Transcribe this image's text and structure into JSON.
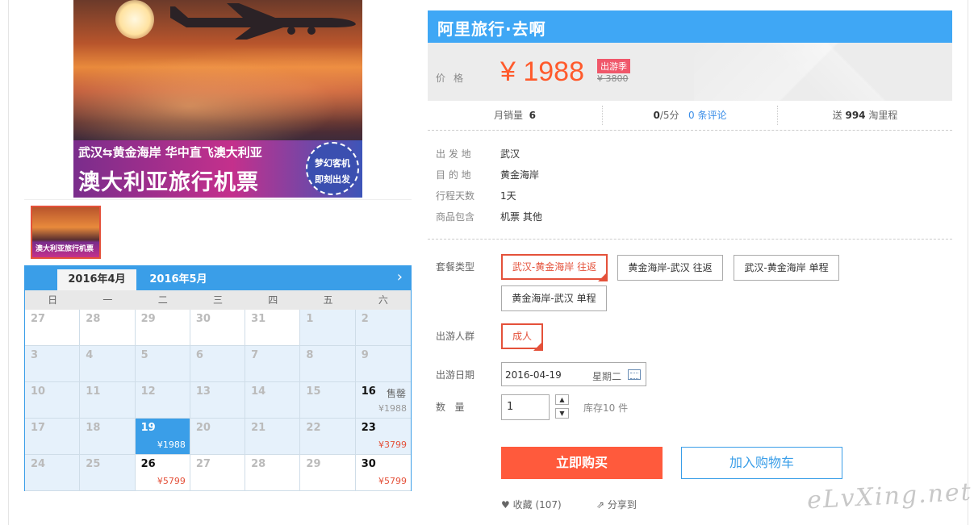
{
  "hero": {
    "line1": "武汉⇆黄金海岸 华中直飞澳大利亚",
    "line2": "澳大利亚旅行机票",
    "stamp_line1": "梦幻客机",
    "stamp_line2": "即刻出发"
  },
  "calendar": {
    "tabs": [
      "2016年4月",
      "2016年5月"
    ],
    "weekdays": [
      "日",
      "一",
      "二",
      "三",
      "四",
      "五",
      "六"
    ],
    "cells": [
      {
        "day": "27",
        "price": "",
        "status": "",
        "state": "white"
      },
      {
        "day": "28",
        "price": "",
        "status": "",
        "state": "white"
      },
      {
        "day": "29",
        "price": "",
        "status": "",
        "state": "white"
      },
      {
        "day": "30",
        "price": "",
        "status": "",
        "state": "white"
      },
      {
        "day": "31",
        "price": "",
        "status": "",
        "state": "white"
      },
      {
        "day": "1",
        "price": "",
        "status": "",
        "state": "off"
      },
      {
        "day": "2",
        "price": "",
        "status": "",
        "state": "off"
      },
      {
        "day": "3",
        "price": "",
        "status": "",
        "state": "off"
      },
      {
        "day": "4",
        "price": "",
        "status": "",
        "state": "off"
      },
      {
        "day": "5",
        "price": "",
        "status": "",
        "state": "off"
      },
      {
        "day": "6",
        "price": "",
        "status": "",
        "state": "off"
      },
      {
        "day": "7",
        "price": "",
        "status": "",
        "state": "off"
      },
      {
        "day": "8",
        "price": "",
        "status": "",
        "state": "off"
      },
      {
        "day": "9",
        "price": "",
        "status": "",
        "state": "off"
      },
      {
        "day": "10",
        "price": "",
        "status": "",
        "state": "off"
      },
      {
        "day": "11",
        "price": "",
        "status": "",
        "state": "off"
      },
      {
        "day": "12",
        "price": "",
        "status": "",
        "state": "off"
      },
      {
        "day": "13",
        "price": "",
        "status": "",
        "state": "off"
      },
      {
        "day": "14",
        "price": "",
        "status": "",
        "state": "off"
      },
      {
        "day": "15",
        "price": "",
        "status": "",
        "state": "off"
      },
      {
        "day": "16",
        "price": "¥1988",
        "status": "售罄",
        "state": "soldout"
      },
      {
        "day": "17",
        "price": "",
        "status": "",
        "state": "off"
      },
      {
        "day": "18",
        "price": "",
        "status": "",
        "state": "off"
      },
      {
        "day": "19",
        "price": "¥1988",
        "status": "",
        "state": "sel"
      },
      {
        "day": "20",
        "price": "",
        "status": "",
        "state": "off"
      },
      {
        "day": "21",
        "price": "",
        "status": "",
        "state": "off"
      },
      {
        "day": "22",
        "price": "",
        "status": "",
        "state": "off"
      },
      {
        "day": "23",
        "price": "¥3799",
        "status": "",
        "state": "avail"
      },
      {
        "day": "24",
        "price": "",
        "status": "",
        "state": "off"
      },
      {
        "day": "25",
        "price": "",
        "status": "",
        "state": "off"
      },
      {
        "day": "26",
        "price": "¥5799",
        "status": "",
        "state": "avail-white"
      },
      {
        "day": "27",
        "price": "",
        "status": "",
        "state": "white-off"
      },
      {
        "day": "28",
        "price": "",
        "status": "",
        "state": "white-off"
      },
      {
        "day": "29",
        "price": "",
        "status": "",
        "state": "white-off"
      },
      {
        "day": "30",
        "price": "¥5799",
        "status": "",
        "state": "avail-white"
      }
    ]
  },
  "product": {
    "title": "阿里旅行·去啊",
    "price_label": "价格",
    "price": "¥ 1988",
    "season_badge": "出游季",
    "original_price": "¥ 3800",
    "stats": {
      "monthly_sales_label": "月销量",
      "monthly_sales": "6",
      "rating": "0",
      "rating_suffix": "/5分",
      "reviews": "0 条评论",
      "miles_prefix": "送",
      "miles": "994",
      "miles_suffix": "淘里程"
    },
    "info": [
      {
        "label": "出 发 地",
        "value": "武汉"
      },
      {
        "label": "目 的 地",
        "value": "黄金海岸"
      },
      {
        "label": "行程天数",
        "value": "1天"
      },
      {
        "label": "商品包含",
        "value": "机票  其他"
      }
    ]
  },
  "options": {
    "package_label": "套餐类型",
    "packages": [
      "武汉-黄金海岸 往返",
      "黄金海岸-武汉 往返",
      "武汉-黄金海岸 单程",
      "黄金海岸-武汉 单程"
    ],
    "traveler_label": "出游人群",
    "traveler": "成人",
    "date_label": "出游日期",
    "date_value": "2016-04-19",
    "date_weekday": "星期二",
    "qty_label": "数   量",
    "qty_value": "1",
    "stock": "库存10 件"
  },
  "actions": {
    "buy": "立即购买",
    "cart": "加入购物车",
    "favorite": "收藏",
    "favorite_count": "(107)",
    "share": "分享到"
  },
  "watermark": "eLvXing.net",
  "colors": {
    "accent_blue": "#3a9ee8",
    "accent_red": "#ff5a3c",
    "price_orange": "#ff5a2c"
  }
}
